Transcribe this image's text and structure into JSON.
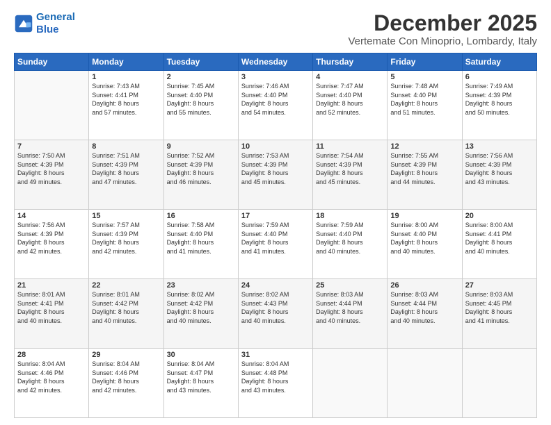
{
  "logo": {
    "line1": "General",
    "line2": "Blue"
  },
  "header": {
    "month": "December 2025",
    "location": "Vertemate Con Minoprio, Lombardy, Italy"
  },
  "weekdays": [
    "Sunday",
    "Monday",
    "Tuesday",
    "Wednesday",
    "Thursday",
    "Friday",
    "Saturday"
  ],
  "weeks": [
    [
      {
        "day": "",
        "info": ""
      },
      {
        "day": "1",
        "info": "Sunrise: 7:43 AM\nSunset: 4:41 PM\nDaylight: 8 hours\nand 57 minutes."
      },
      {
        "day": "2",
        "info": "Sunrise: 7:45 AM\nSunset: 4:40 PM\nDaylight: 8 hours\nand 55 minutes."
      },
      {
        "day": "3",
        "info": "Sunrise: 7:46 AM\nSunset: 4:40 PM\nDaylight: 8 hours\nand 54 minutes."
      },
      {
        "day": "4",
        "info": "Sunrise: 7:47 AM\nSunset: 4:40 PM\nDaylight: 8 hours\nand 52 minutes."
      },
      {
        "day": "5",
        "info": "Sunrise: 7:48 AM\nSunset: 4:40 PM\nDaylight: 8 hours\nand 51 minutes."
      },
      {
        "day": "6",
        "info": "Sunrise: 7:49 AM\nSunset: 4:39 PM\nDaylight: 8 hours\nand 50 minutes."
      }
    ],
    [
      {
        "day": "7",
        "info": "Sunrise: 7:50 AM\nSunset: 4:39 PM\nDaylight: 8 hours\nand 49 minutes."
      },
      {
        "day": "8",
        "info": "Sunrise: 7:51 AM\nSunset: 4:39 PM\nDaylight: 8 hours\nand 47 minutes."
      },
      {
        "day": "9",
        "info": "Sunrise: 7:52 AM\nSunset: 4:39 PM\nDaylight: 8 hours\nand 46 minutes."
      },
      {
        "day": "10",
        "info": "Sunrise: 7:53 AM\nSunset: 4:39 PM\nDaylight: 8 hours\nand 45 minutes."
      },
      {
        "day": "11",
        "info": "Sunrise: 7:54 AM\nSunset: 4:39 PM\nDaylight: 8 hours\nand 45 minutes."
      },
      {
        "day": "12",
        "info": "Sunrise: 7:55 AM\nSunset: 4:39 PM\nDaylight: 8 hours\nand 44 minutes."
      },
      {
        "day": "13",
        "info": "Sunrise: 7:56 AM\nSunset: 4:39 PM\nDaylight: 8 hours\nand 43 minutes."
      }
    ],
    [
      {
        "day": "14",
        "info": "Sunrise: 7:56 AM\nSunset: 4:39 PM\nDaylight: 8 hours\nand 42 minutes."
      },
      {
        "day": "15",
        "info": "Sunrise: 7:57 AM\nSunset: 4:39 PM\nDaylight: 8 hours\nand 42 minutes."
      },
      {
        "day": "16",
        "info": "Sunrise: 7:58 AM\nSunset: 4:40 PM\nDaylight: 8 hours\nand 41 minutes."
      },
      {
        "day": "17",
        "info": "Sunrise: 7:59 AM\nSunset: 4:40 PM\nDaylight: 8 hours\nand 41 minutes."
      },
      {
        "day": "18",
        "info": "Sunrise: 7:59 AM\nSunset: 4:40 PM\nDaylight: 8 hours\nand 40 minutes."
      },
      {
        "day": "19",
        "info": "Sunrise: 8:00 AM\nSunset: 4:40 PM\nDaylight: 8 hours\nand 40 minutes."
      },
      {
        "day": "20",
        "info": "Sunrise: 8:00 AM\nSunset: 4:41 PM\nDaylight: 8 hours\nand 40 minutes."
      }
    ],
    [
      {
        "day": "21",
        "info": "Sunrise: 8:01 AM\nSunset: 4:41 PM\nDaylight: 8 hours\nand 40 minutes."
      },
      {
        "day": "22",
        "info": "Sunrise: 8:01 AM\nSunset: 4:42 PM\nDaylight: 8 hours\nand 40 minutes."
      },
      {
        "day": "23",
        "info": "Sunrise: 8:02 AM\nSunset: 4:42 PM\nDaylight: 8 hours\nand 40 minutes."
      },
      {
        "day": "24",
        "info": "Sunrise: 8:02 AM\nSunset: 4:43 PM\nDaylight: 8 hours\nand 40 minutes."
      },
      {
        "day": "25",
        "info": "Sunrise: 8:03 AM\nSunset: 4:44 PM\nDaylight: 8 hours\nand 40 minutes."
      },
      {
        "day": "26",
        "info": "Sunrise: 8:03 AM\nSunset: 4:44 PM\nDaylight: 8 hours\nand 40 minutes."
      },
      {
        "day": "27",
        "info": "Sunrise: 8:03 AM\nSunset: 4:45 PM\nDaylight: 8 hours\nand 41 minutes."
      }
    ],
    [
      {
        "day": "28",
        "info": "Sunrise: 8:04 AM\nSunset: 4:46 PM\nDaylight: 8 hours\nand 42 minutes."
      },
      {
        "day": "29",
        "info": "Sunrise: 8:04 AM\nSunset: 4:46 PM\nDaylight: 8 hours\nand 42 minutes."
      },
      {
        "day": "30",
        "info": "Sunrise: 8:04 AM\nSunset: 4:47 PM\nDaylight: 8 hours\nand 43 minutes."
      },
      {
        "day": "31",
        "info": "Sunrise: 8:04 AM\nSunset: 4:48 PM\nDaylight: 8 hours\nand 43 minutes."
      },
      {
        "day": "",
        "info": ""
      },
      {
        "day": "",
        "info": ""
      },
      {
        "day": "",
        "info": ""
      }
    ]
  ]
}
